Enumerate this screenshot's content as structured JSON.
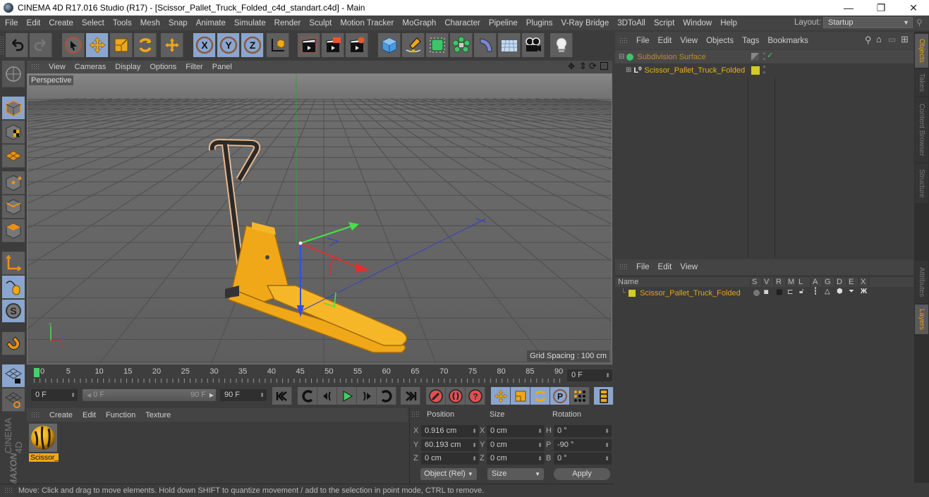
{
  "window": {
    "title": "CINEMA 4D R17.016 Studio (R17) - [Scissor_Pallet_Truck_Folded_c4d_standart.c4d] - Main",
    "controls": [
      "minimize",
      "restore",
      "close"
    ]
  },
  "menubar": {
    "items": [
      "File",
      "Edit",
      "Create",
      "Select",
      "Tools",
      "Mesh",
      "Snap",
      "Animate",
      "Simulate",
      "Render",
      "Sculpt",
      "Motion Tracker",
      "MoGraph",
      "Character",
      "Pipeline",
      "Plugins",
      "V-Ray Bridge",
      "3DToAll",
      "Script",
      "Window",
      "Help"
    ],
    "layout_label": "Layout:",
    "layout_value": "Startup"
  },
  "toolbar": {
    "groups": [
      [
        "undo-icon",
        "redo-icon"
      ],
      [
        "live-selection-icon",
        "move-icon",
        "scale-icon",
        "rotate-icon",
        "last-tool-icon"
      ],
      [
        "x-axis-lock-icon",
        "y-axis-lock-icon",
        "z-axis-lock-icon",
        "coordinate-system-icon"
      ],
      [
        "render-view-icon",
        "render-picture-viewer-icon",
        "render-settings-icon"
      ],
      [
        "cube-icon",
        "pen-spline-icon",
        "subdivision-surface-icon",
        "cloner-icon",
        "deformer-bend-icon",
        "floor-icon",
        "camera-icon",
        "light-icon"
      ]
    ]
  },
  "left_tools": [
    "model-mode-icon",
    "texture-mode-icon",
    "workplane-mode-icon",
    "points-mode-icon",
    "edges-mode-icon",
    "polygons-mode-icon",
    "enable-axis-icon",
    "tweak-mode-icon",
    "solo-icon",
    "snap-magnet-icon",
    "lock-workplane-icon",
    "planar-workplane-icon"
  ],
  "viewport": {
    "menu": [
      "View",
      "Cameras",
      "Display",
      "Options",
      "Filter",
      "Panel"
    ],
    "camera_label": "Perspective",
    "grid_spacing": "Grid Spacing : 100 cm",
    "nav_icons": [
      "move-view-icon",
      "dolly-view-icon",
      "rotate-view-icon",
      "toggle-layout-icon"
    ]
  },
  "timeline": {
    "ticks": [
      "0",
      "5",
      "10",
      "15",
      "20",
      "25",
      "30",
      "35",
      "40",
      "45",
      "50",
      "55",
      "60",
      "65",
      "70",
      "75",
      "80",
      "85",
      "90"
    ],
    "current_frame": "0 F",
    "start_field": "0 F",
    "range_start": "0 F",
    "range_end": "90 F",
    "end_field": "90 F"
  },
  "transport": {
    "buttons": [
      "go-to-start-icon",
      "previous-key-icon",
      "previous-frame-icon",
      "play-icon",
      "next-frame-icon",
      "next-key-icon",
      "go-to-end-icon",
      "record-keys-icon",
      "autokeying-icon",
      "keyframe-selection-icon",
      "key-position-icon",
      "key-scale-icon",
      "key-rotation-icon",
      "key-parameter-icon",
      "key-point-level-icon",
      "timeline-icon"
    ]
  },
  "material_manager": {
    "menu": [
      "Create",
      "Edit",
      "Function",
      "Texture"
    ],
    "materials": [
      {
        "name": "Scissor_"
      }
    ]
  },
  "coordinates": {
    "headers": [
      "Position",
      "Size",
      "Rotation"
    ],
    "rows": [
      {
        "pos_label": "X",
        "pos": "0.916 cm",
        "size_label": "X",
        "size": "0 cm",
        "rot_label": "H",
        "rot": "0 °"
      },
      {
        "pos_label": "Y",
        "pos": "60.193 cm",
        "size_label": "Y",
        "size": "0 cm",
        "rot_label": "P",
        "rot": "-90 °"
      },
      {
        "pos_label": "Z",
        "pos": "0 cm",
        "size_label": "Z",
        "size": "0 cm",
        "rot_label": "B",
        "rot": "0 °"
      }
    ],
    "mode_select": "Object (Rel)",
    "size_select": "Size",
    "apply_label": "Apply"
  },
  "status": {
    "text": "Move: Click and drag to move elements. Hold down SHIFT to quantize movement / add to the selection in point mode, CTRL to remove."
  },
  "object_manager": {
    "menu": [
      "File",
      "Edit",
      "View",
      "Objects",
      "Tags",
      "Bookmarks"
    ],
    "objects": [
      {
        "name": "Subdivision Surface",
        "color": "#c08a2a",
        "enabled_check": "✓"
      },
      {
        "name": "Scissor_Pallet_Truck_Folded",
        "color": "#e8b020",
        "layer_color": "#d4cc20"
      }
    ]
  },
  "layer_manager": {
    "menu": [
      "File",
      "Edit",
      "View"
    ],
    "columns": [
      "Name",
      "S",
      "V",
      "R",
      "M",
      "L",
      "A",
      "G",
      "D",
      "E",
      "X"
    ],
    "layers": [
      {
        "name": "Scissor_Pallet_Truck_Folded",
        "color": "#d4cc20"
      }
    ]
  },
  "right_tabs": {
    "top": [
      {
        "label": "Objects",
        "active": true
      },
      {
        "label": "Takes",
        "active": false
      },
      {
        "label": "Content Browser",
        "active": false
      },
      {
        "label": "Structure",
        "active": false
      }
    ],
    "bottom": [
      {
        "label": "Attributes",
        "active": false
      },
      {
        "label": "Layers",
        "active": true
      }
    ]
  },
  "branding": {
    "line1": "MAXON",
    "line2": "CINEMA 4D"
  },
  "colors": {
    "accent_orange": "#e8a21c",
    "selected_blue": "#8aa6cf",
    "panel_bg": "#3c3c3c",
    "viewport_bg": "#6a6a6a"
  }
}
